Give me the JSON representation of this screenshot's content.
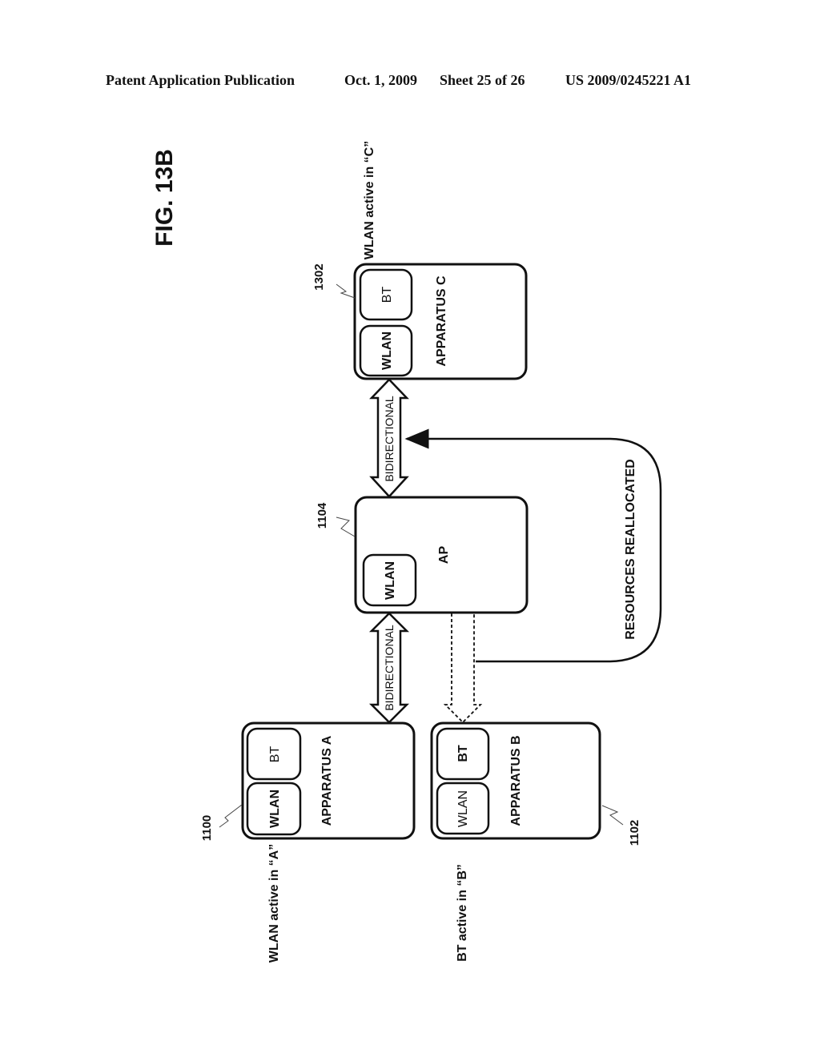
{
  "header": {
    "publication": "Patent Application Publication",
    "date": "Oct. 1, 2009",
    "sheet": "Sheet 25 of 26",
    "number": "US 2009/0245221 A1"
  },
  "figure": {
    "title": "FIG. 13B",
    "nodes": {
      "apparatus_a": {
        "label": "APPARATUS A",
        "ref": "1100",
        "modules": [
          "WLAN",
          "BT"
        ],
        "status": "WLAN active in “A”"
      },
      "apparatus_b": {
        "label": "APPARATUS B",
        "ref": "1102",
        "modules": [
          "WLAN",
          "BT"
        ],
        "status": "BT active in “B”"
      },
      "ap": {
        "label": "AP",
        "ref": "1104",
        "modules": [
          "WLAN"
        ]
      },
      "apparatus_c": {
        "label": "APPARATUS C",
        "ref": "1302",
        "modules": [
          "WLAN",
          "BT"
        ],
        "status": "WLAN active in “C”"
      }
    },
    "links": {
      "ap_to_a": "BIDIRECTIONAL",
      "ap_to_c": "BIDIRECTIONAL",
      "reallocation": "RESOURCES REALLOCATED"
    }
  }
}
